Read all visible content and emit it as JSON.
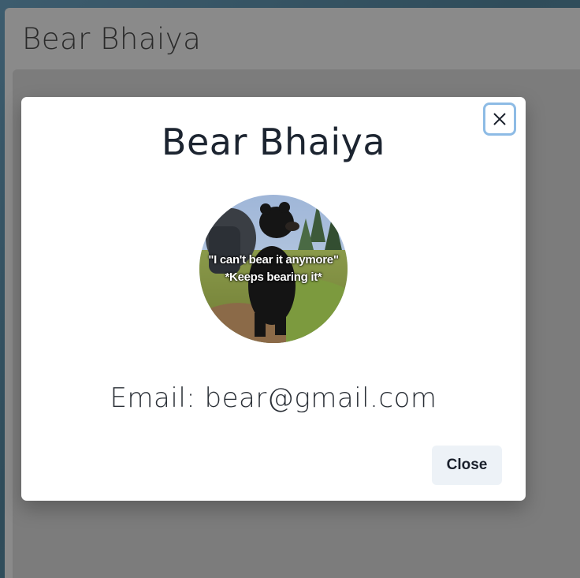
{
  "background": {
    "title": "Bear Bhaiya"
  },
  "modal": {
    "title": "Bear Bhaiya",
    "avatar_caption_line1": "\"I can't bear it anymore\"",
    "avatar_caption_line2": "*Keeps bearing it*",
    "email": "Email: bear@gmail.com",
    "close_button_label": "Close",
    "close_icon": "close-icon"
  },
  "colors": {
    "overlay": "#808080",
    "modal_bg": "#ffffff",
    "focus_ring": "#8dbbe5",
    "close_button_bg": "#edf2f7"
  }
}
